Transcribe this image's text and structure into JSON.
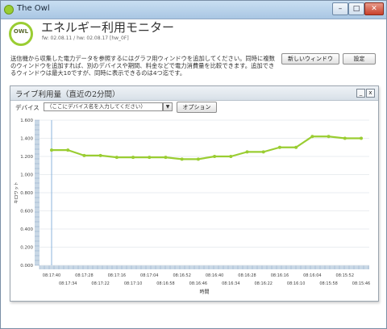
{
  "window": {
    "title": "The Owl",
    "min_glyph": "–",
    "max_glyph": "□",
    "close_glyph": "✕",
    "accent": "#9acd32"
  },
  "header": {
    "logo_text": "OWL",
    "app_title": "エネルギー利用モニター",
    "meta": "fw: 02.08.11 / hw: 02.08.17 [hw_0F]",
    "description": "送信機から収集した電力データを参照するにはグラフ用ウィンドウを追加してください。同時に複数のウィンドウを追加すれば、別のデバイスや期間、料金などで電力消費量を比較できます。追加できるウィンドウは最大10ですが、同時に表示できるのは4つ迄です。",
    "new_window_label": "新しいウィンドウ",
    "settings_label": "設定"
  },
  "panel": {
    "title": "ライブ利用量（直近の2分間）",
    "min_glyph": "_",
    "close_glyph": "x",
    "device_label": "デバイス",
    "device_value": "（ここにデバイス名を入力してください）",
    "dropdown_glyph": "▼",
    "options_label": "オプション"
  },
  "chart_data": {
    "type": "line",
    "title": "",
    "xlabel": "時間",
    "ylabel": "キロワット",
    "ylim": [
      0,
      1.6
    ],
    "y_ticks": [
      "0.000",
      "0.200",
      "0.400",
      "0.600",
      "0.800",
      "1.000",
      "1.200",
      "1.400",
      "1.600"
    ],
    "x_ticks_upper": [
      "08:17:40",
      "08:17:28",
      "08:17:16",
      "08:17:04",
      "08:16:52",
      "08:16:40",
      "08:16:28",
      "08:16:16",
      "08:16:04",
      "08:15:52"
    ],
    "x_ticks_lower": [
      "08:17:34",
      "08:17:22",
      "08:17:10",
      "08:16:58",
      "08:16:46",
      "08:16:34",
      "08:16:22",
      "08:16:10",
      "08:15:58",
      "08:15:46"
    ],
    "series": [
      {
        "color": "#9acd32",
        "values": [
          1.27,
          1.27,
          1.21,
          1.21,
          1.19,
          1.19,
          1.19,
          1.19,
          1.17,
          1.17,
          1.2,
          1.2,
          1.25,
          1.25,
          1.3,
          1.3,
          1.42,
          1.42,
          1.4,
          1.4
        ]
      }
    ]
  }
}
